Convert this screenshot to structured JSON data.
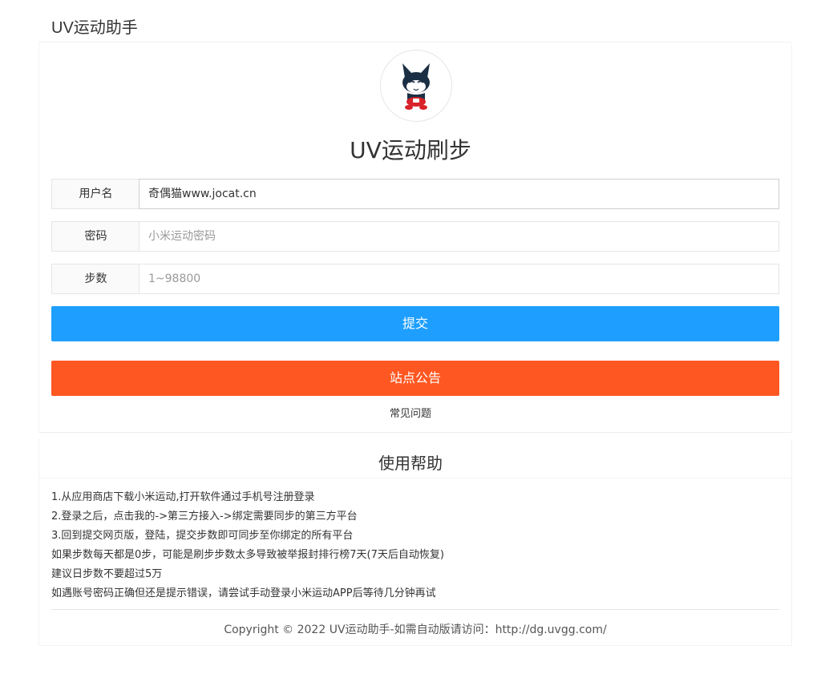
{
  "header": {
    "app_title": "UV运动助手"
  },
  "main": {
    "title": "UV运动刷步",
    "form": {
      "username": {
        "label": "用户名",
        "value": "奇偶猫www.jocat.cn",
        "placeholder": ""
      },
      "password": {
        "label": "密码",
        "value": "",
        "placeholder": "小米运动密码"
      },
      "steps": {
        "label": "步数",
        "value": "",
        "placeholder": "1~98800"
      }
    },
    "submit_label": "提交",
    "notice_label": "站点公告",
    "faq_label": "常见问题"
  },
  "help": {
    "title": "使用帮助",
    "items": [
      "1.从应用商店下载小米运动,打开软件通过手机号注册登录",
      "2.登录之后，点击我的->第三方接入->绑定需要同步的第三方平台",
      "3.回到提交网页版，登陆，提交步数即可同步至你绑定的所有平台",
      "如果步数每天都是0步，可能是刷步步数太多导致被举报封排行榜7天(7天后自动恢复)",
      "建议日步数不要超过5万",
      "如遇账号密码正确但还是提示错误，请尝试手动登录小米运动APP后等待几分钟再试"
    ]
  },
  "footer": {
    "copyright": "Copyright © 2022 UV运动助手-如需自动版请访问：http://dg.uvgg.com/"
  },
  "colors": {
    "primary": "#1e9fff",
    "notice": "#ff5722",
    "logo_red": "#d8232a",
    "logo_navy": "#1b2f44"
  }
}
